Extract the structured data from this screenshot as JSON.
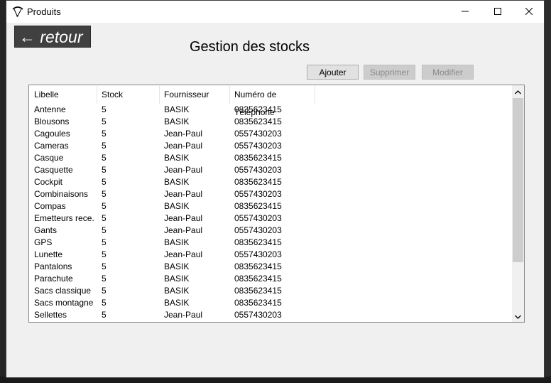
{
  "window": {
    "title": "Produits"
  },
  "nav": {
    "back_label": "← retour"
  },
  "page": {
    "heading": "Gestion des stocks"
  },
  "toolbar": {
    "add_label": "Ajouter",
    "delete_label": "Supprimer",
    "edit_label": "Modifier"
  },
  "table": {
    "columns": [
      "Libelle",
      "Stock",
      "Fournisseur",
      "Numéro de Téléphone"
    ],
    "rows": [
      [
        "Antenne",
        "5",
        "BASIK",
        "0835623415"
      ],
      [
        "Blousons",
        "5",
        "BASIK",
        "0835623415"
      ],
      [
        "Cagoules",
        "5",
        "Jean-Paul",
        "0557430203"
      ],
      [
        "Cameras",
        "5",
        "Jean-Paul",
        "0557430203"
      ],
      [
        "Casque",
        "5",
        "BASIK",
        "0835623415"
      ],
      [
        "Casquette",
        "5",
        "Jean-Paul",
        "0557430203"
      ],
      [
        "Cockpit",
        "5",
        "BASIK",
        "0835623415"
      ],
      [
        "Combinaisons",
        "5",
        "Jean-Paul",
        "0557430203"
      ],
      [
        "Compas",
        "5",
        "BASIK",
        "0835623415"
      ],
      [
        "Emetteurs rece...",
        "5",
        "Jean-Paul",
        "0557430203"
      ],
      [
        "Gants",
        "5",
        "Jean-Paul",
        "0557430203"
      ],
      [
        "GPS",
        "5",
        "BASIK",
        "0835623415"
      ],
      [
        "Lunette",
        "5",
        "Jean-Paul",
        "0557430203"
      ],
      [
        "Pantalons",
        "5",
        "BASIK",
        "0835623415"
      ],
      [
        "Parachute",
        "5",
        "BASIK",
        "0835623415"
      ],
      [
        "Sacs classique",
        "5",
        "BASIK",
        "0835623415"
      ],
      [
        "Sacs montagne",
        "5",
        "BASIK",
        "0835623415"
      ],
      [
        "Sellettes",
        "5",
        "Jean-Paul",
        "0557430203"
      ]
    ]
  },
  "icons": {
    "app": "paraglider-icon",
    "minimize": "minimize-icon",
    "maximize": "maximize-icon",
    "close": "close-icon"
  }
}
